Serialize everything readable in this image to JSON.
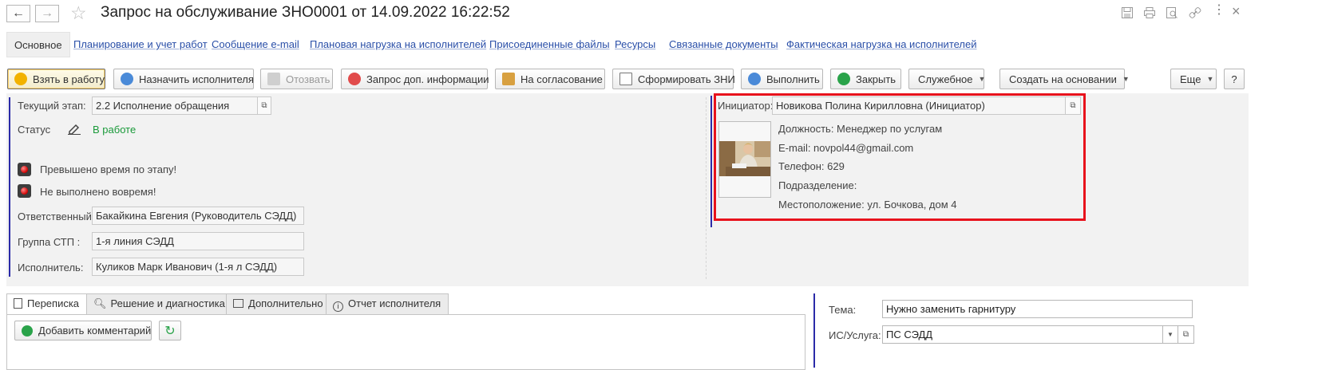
{
  "window": {
    "title": "Запрос на обслуживание ЗНО0001 от 14.09.2022 16:22:52",
    "tools": [
      "save-icon",
      "print-icon",
      "preview-icon",
      "link-icon",
      "more-icon",
      "close-icon"
    ]
  },
  "sections": {
    "active": "Основное",
    "links": [
      "Планирование и учет работ",
      "Сообщение e-mail",
      "Плановая нагрузка на исполнителей",
      "Присоединенные файлы",
      "Ресурсы",
      "Связанные документы",
      "Фактическая нагрузка на исполнителей"
    ]
  },
  "commands": {
    "take": "Взять в работу",
    "assign": "Назначить исполнителя",
    "recall": "Отозвать",
    "request_info": "Запрос доп. информации",
    "approval": "На согласование",
    "form_zni": "Сформировать ЗНИ",
    "execute": "Выполнить",
    "close": "Закрыть",
    "service": "Служебное",
    "create_based": "Создать на основании",
    "more": "Еще",
    "help": "?"
  },
  "status_block": {
    "stage_label": "Текущий этап:",
    "stage_value": "2.2 Исполнение обращения",
    "status_label": "Статус",
    "status_value": "В работе",
    "warning_time": "Превышено время по этапу!",
    "warning_late": "Не выполнено вовремя!",
    "responsible_label": "Ответственный:",
    "responsible_value": "Бакайкина Евгения (Руководитель СЭДД)",
    "group_label": "Группа СТП :",
    "group_value": "1-я линия СЭДД",
    "executor_label": "Исполнитель:",
    "executor_value": "Куликов Марк Иванович (1-я л СЭДД)"
  },
  "initiator": {
    "label": "Инициатор:",
    "value": "Новикова Полина Кирилловна (Инициатор)",
    "position": "Должность: Менеджер по услугам",
    "email": "E-mail: novpol44@gmail.com",
    "phone": "Телефон: 629",
    "department": "Подразделение:",
    "location": "Местоположение: ул. Бочкова, дом 4"
  },
  "bottom_tabs": [
    "Переписка",
    "Решение и диагностика",
    "Дополнительно",
    "Отчет исполнителя"
  ],
  "correspondence": {
    "add_comment": "Добавить комментарий"
  },
  "details": {
    "subject_label": "Тема:",
    "subject_value": "Нужно заменить гарнитуру",
    "service_label": "ИС/Услуга:",
    "service_value": "ПС СЭДД"
  },
  "colors": {
    "link": "#2a4fa8",
    "status_ok": "#1a9a3a",
    "highlight_box": "#e8121c",
    "group_marker": "#2b2ba8"
  }
}
